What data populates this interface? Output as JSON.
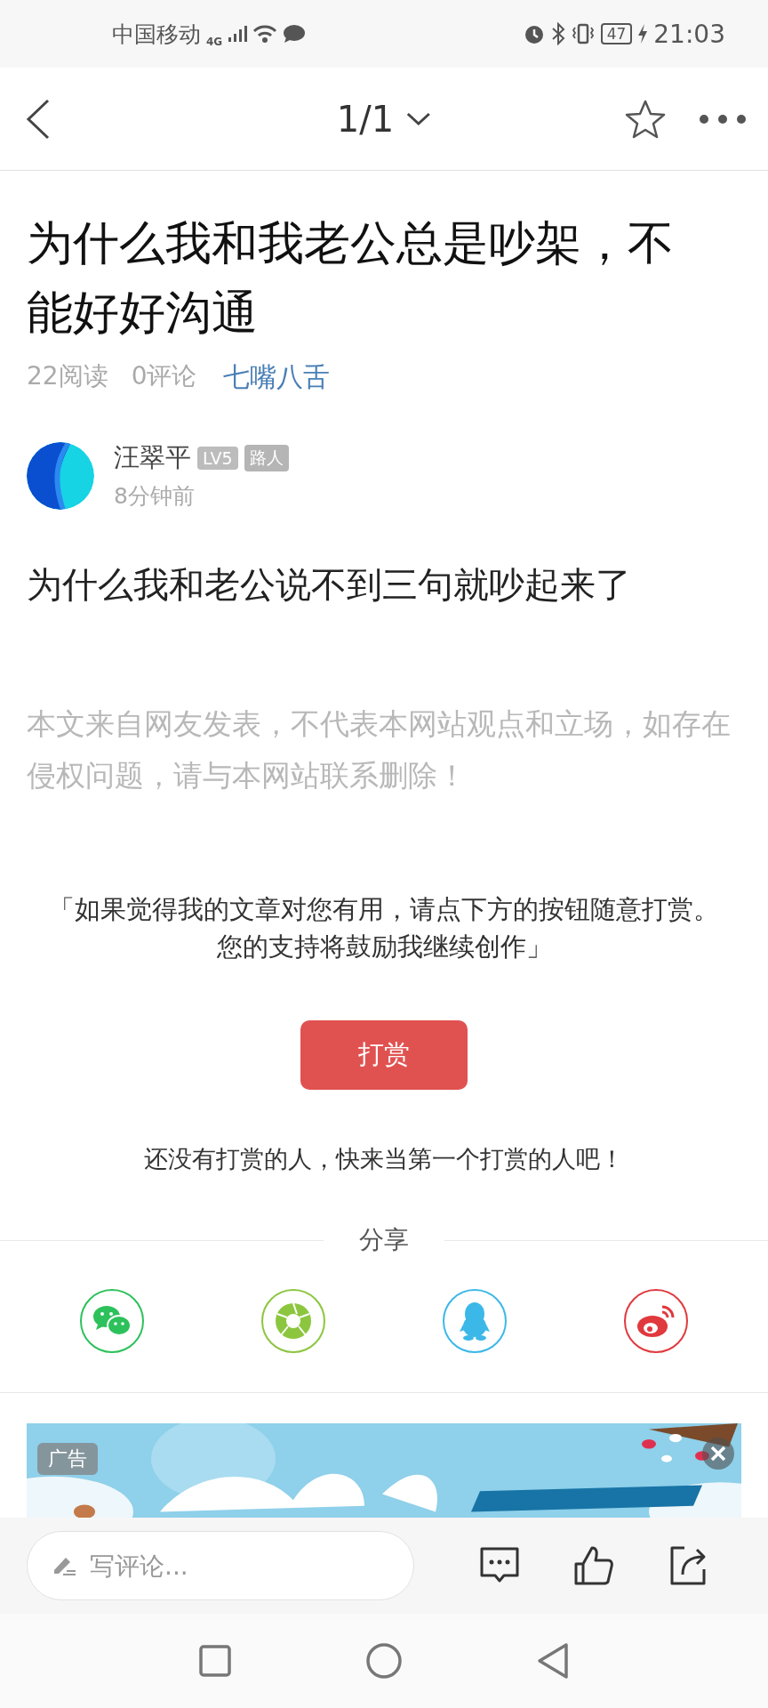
{
  "status_bar": {
    "carrier": "中国移动",
    "network": "4G",
    "battery": "47",
    "time": "21:03"
  },
  "nav": {
    "page": "1/1"
  },
  "article": {
    "title": "为什么我和我老公总是吵架，不能好好沟通",
    "reads": "22阅读",
    "comments": "0评论",
    "category": "七嘴八舌",
    "author": {
      "name": "汪翠平",
      "level": "LV5",
      "rank": "路人",
      "time": "8分钟前"
    },
    "body": "为什么我和老公说不到三句就吵起来了",
    "disclaimer": "本文来自网友发表，不代表本网站观点和立场，如存在侵权问题，请与本网站联系删除！"
  },
  "reward": {
    "quote": "「如果觉得我的文章对您有用，请点下方的按钮随意打赏。您的支持将鼓励我继续创作」",
    "button": "打赏",
    "empty_note": "还没有打赏的人，快来当第一个打赏的人吧！"
  },
  "share": {
    "label": "分享",
    "targets": [
      {
        "kind": "wechat",
        "color": "#2dc15b"
      },
      {
        "kind": "moments",
        "color": "#8cc63f"
      },
      {
        "kind": "qq",
        "color": "#3bb8e8"
      },
      {
        "kind": "weibo",
        "color": "#e0393e"
      }
    ]
  },
  "ad": {
    "kind": "picture",
    "badge": "广告"
  },
  "comment_bar": {
    "placeholder": "写评论..."
  }
}
